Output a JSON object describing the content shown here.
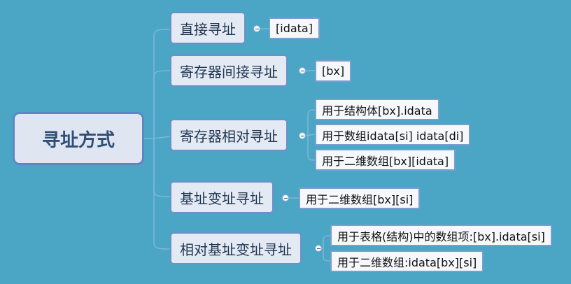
{
  "root": {
    "label": "寻址方式"
  },
  "branches": [
    {
      "label": "直接寻址",
      "leaves": [
        "[idata]"
      ]
    },
    {
      "label": "寄存器间接寻址",
      "leaves": [
        "[bx]"
      ]
    },
    {
      "label": "寄存器相对寻址",
      "leaves": [
        "用于结构体[bx].idata",
        "用于数组idata[si] idata[di]",
        "用于二维数组[bx][idata]"
      ]
    },
    {
      "label": "基址变址寻址",
      "leaves": [
        "用于二维数组[bx][si]"
      ]
    },
    {
      "label": "相对基址变址寻址",
      "leaves": [
        "用于表格(结构)中的数组项:[bx].idata[si]",
        "用于二维数组:idata[bx][si]"
      ]
    }
  ],
  "colors": {
    "background": "#4aa6c4",
    "connector": "#7fb6d8"
  }
}
